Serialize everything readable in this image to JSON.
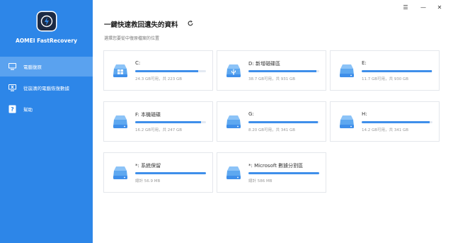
{
  "app": {
    "name": "AOMEI FastRecovery"
  },
  "window_controls": {
    "menu": "☰",
    "minimize": "—",
    "close": "✕"
  },
  "sidebar": {
    "items": [
      {
        "label": "電腦復原",
        "icon": "monitor-icon"
      },
      {
        "label": "從崩潰的電腦恢復數據",
        "icon": "crashed-pc-icon"
      },
      {
        "label": "幫助",
        "icon": "help-icon"
      }
    ]
  },
  "main": {
    "title": "一鍵快速救回遺失的資料",
    "subtitle": "選擇您要從中復原檔案的位置"
  },
  "drives": [
    {
      "name": "C:",
      "size": "24.3 GB可用，共 223 GB",
      "fill": 0.89,
      "type": "windows"
    },
    {
      "name": "D: 新增磁碟區",
      "size": "38.7 GB可用，共 931 GB",
      "fill": 0.96,
      "type": "usb"
    },
    {
      "name": "E:",
      "size": "11.7 GB可用，共 930 GB",
      "fill": 0.99,
      "type": "disk"
    },
    {
      "name": "F: 本機磁碟",
      "size": "16.2 GB可用，共 247 GB",
      "fill": 0.93,
      "type": "disk"
    },
    {
      "name": "G:",
      "size": "8.20 GB可用，共 341 GB",
      "fill": 0.98,
      "type": "disk"
    },
    {
      "name": "H:",
      "size": "14.2 GB可用，共 341 GB",
      "fill": 0.96,
      "type": "disk"
    },
    {
      "name": "*: 系統保留",
      "size": "總計 56.9 MB",
      "fill": 1.0,
      "type": "disk"
    },
    {
      "name": "*: Microsoft 數據分割區",
      "size": "總計 586 MB",
      "fill": 1.0,
      "type": "disk"
    }
  ]
}
